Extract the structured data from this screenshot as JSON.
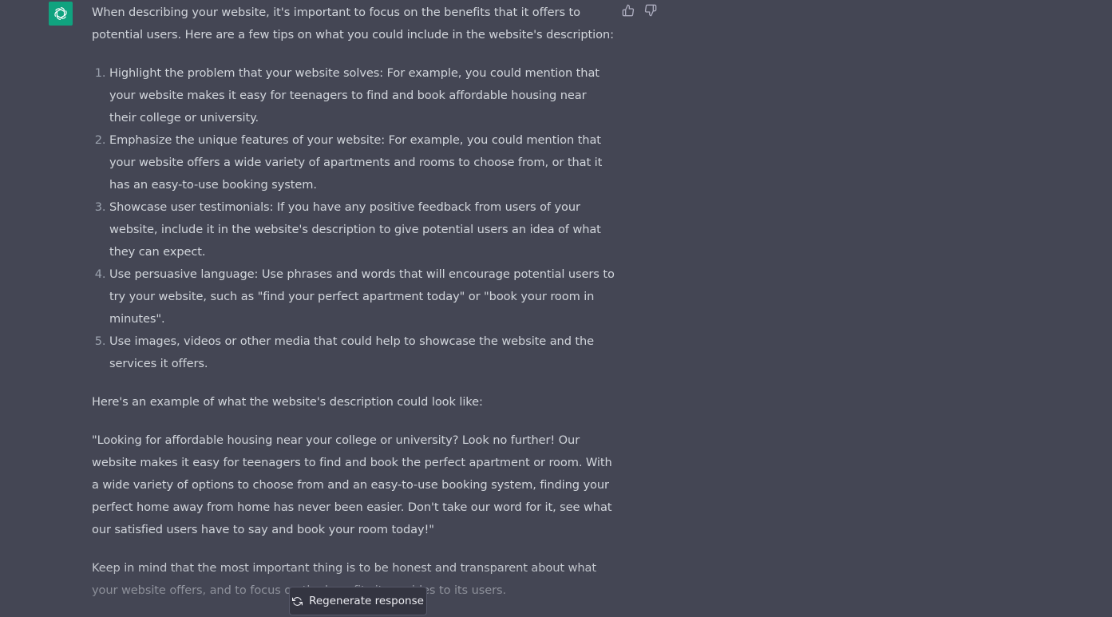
{
  "message": {
    "intro": "When describing your website, it's important to focus on the benefits that it offers to potential users. Here are a few tips on what you could include in the website's description:",
    "tips": [
      "Highlight the problem that your website solves: For example, you could mention that your website makes it easy for teenagers to find and book affordable housing near their college or university.",
      "Emphasize the unique features of your website: For example, you could mention that your website offers a wide variety of apartments and rooms to choose from, or that it has an easy-to-use booking system.",
      "Showcase user testimonials: If you have any positive feedback from users of your website, include it in the website's description to give potential users an idea of what they can expect.",
      "Use persuasive language: Use phrases and words that will encourage potential users to try your website, such as \"find your perfect apartment today\" or \"book your room in minutes\".",
      "Use images, videos or other media that could help to showcase the website and the services it offers."
    ],
    "example_intro": "Here's an example of what the website's description could look like:",
    "example": "\"Looking for affordable housing near your college or university? Look no further! Our website makes it easy for teenagers to find and book the perfect apartment or room. With a wide variety of options to choose from and an easy-to-use booking system, finding your perfect home away from home has never been easier. Don't take our word for it, see what our satisfied users have to say and book your room today!\"",
    "closing": "Keep in mind that the most important thing is to be honest and transparent about what your website offers, and to focus on the benefits it provides to its users."
  },
  "icons": {
    "avatar": "openai-logo-icon",
    "thumbs_up": "thumbs-up-icon",
    "thumbs_down": "thumbs-down-icon",
    "regenerate": "refresh-icon"
  },
  "regenerate_button": {
    "label": "Regenerate response"
  },
  "colors": {
    "background": "#444654",
    "avatar_bg": "#10a37f",
    "text": "#d1d5db",
    "button_bg": "#343541"
  }
}
